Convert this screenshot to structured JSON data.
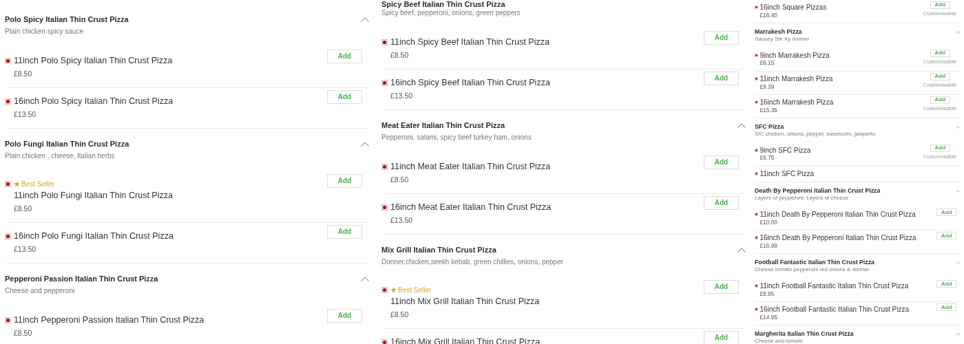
{
  "columns": [
    {
      "sections": [
        {
          "title": "Polo Spicy Italian Thin Crust Pizza",
          "description": "Plain chicken spicy sauce",
          "expanded": true,
          "items": [
            {
              "name": "11inch Polo Spicy Italian Thin Crust Pizza",
              "price": "£8.50",
              "button": "Add"
            },
            {
              "name": "16inch Polo Spicy Italian Thin Crust Pizza",
              "price": "£13.50",
              "button": "Add"
            }
          ]
        },
        {
          "title": "Polo Fungi Italian Thin Crust Pizza",
          "description": "Plain chicken , cheese, Italian herbs",
          "expanded": true,
          "items": [
            {
              "badge": "Best Seller",
              "name": "11inch Polo Fungi Italian Thin Crust Pizza",
              "price": "£8.50",
              "button": "Add"
            },
            {
              "name": "16inch Polo Fungi Italian Thin Crust Pizza",
              "price": "£13.50",
              "button": "Add"
            }
          ]
        },
        {
          "title": "Pepperoni Passion Italian Thin Crust Pizza",
          "description": "Cheese and pepperoni",
          "expanded": true,
          "items": [
            {
              "name": "11inch Pepperoni Passion Italian Thin Crust Pizza",
              "price": "£8.50",
              "button": "Add"
            }
          ]
        }
      ]
    },
    {
      "sections": [
        {
          "title": "Spicy Beef Italian Thin Crust Pizza",
          "description": "Spicy beef, pepperoni, onions, green peppers",
          "items": [
            {
              "name": "11inch Spicy Beef Italian Thin Crust Pizza",
              "price": "£8.50",
              "button": "Add"
            },
            {
              "name": "16inch Spicy Beef Italian Thin Crust Pizza",
              "price": "£13.50",
              "button": "Add"
            }
          ]
        },
        {
          "title": "Meat Eater Italian Thin Crust Pizza",
          "description": "Pepperoni, salami, spicy beef turkey ham, onions",
          "expanded": true,
          "items": [
            {
              "name": "11inch Meat Eater Italian Thin Crust Pizza",
              "price": "£8.50",
              "button": "Add"
            },
            {
              "name": "16inch Meat Eater Italian Thin Crust Pizza",
              "price": "£13.50",
              "button": "Add"
            }
          ]
        },
        {
          "title": "Mix Grill Italian Thin Crust Pizza",
          "description": "Donner,chicken,seekh kebab, green chillies, onions, pepper",
          "expanded": true,
          "items": [
            {
              "badge": "Best Seller",
              "name": "11inch Mix Grill Italian Thin Crust Pizza",
              "price": "£8.50",
              "button": "Add"
            },
            {
              "name": "16inch Mix Grill Italian Thin Crust Pizza",
              "button": "Add"
            }
          ]
        }
      ]
    },
    {
      "sections": [
        {
          "items": [
            {
              "name": "16inch Square Pizzas",
              "price": "£16.40",
              "button": "Add",
              "note": "Customisable"
            }
          ]
        },
        {
          "title": "Marrakesh Pizza",
          "description": "Saucey Stir fry donner",
          "expanded": true,
          "items": [
            {
              "name": "9inch Marrakesh Pizza",
              "price": "£6.15",
              "button": "Add",
              "note": "Customisable"
            },
            {
              "name": "11inch Marrakesh Pizza",
              "price": "£9.39",
              "button": "Add",
              "note": "Customisable"
            },
            {
              "name": "16inch Marrakesh Pizza",
              "price": "£15.35",
              "button": "Add",
              "note": "Customisable"
            }
          ]
        },
        {
          "title": "SFC Pizza",
          "description": "SfC chicken, onions, pepper, sweetcorn, jalapeño",
          "expanded": true,
          "items": [
            {
              "name": "9inch SFC Pizza",
              "price": "£6.75",
              "button": "Add",
              "note": "Customisable"
            },
            {
              "name": "11inch SFC Pizza"
            }
          ]
        },
        {
          "title": "Death By Pepperoni Italian Thin Crust Pizza",
          "description": "Layers of pepperoni. Layers of cheese",
          "expanded": true,
          "items": [
            {
              "name": "11inch Death By Pepperoni Italian Thin Crust Pizza",
              "price": "£10.00",
              "button": "Add"
            },
            {
              "name": "16inch Death By Pepperoni Italian Thin Crust Pizza",
              "price": "£16.99",
              "button": "Add"
            }
          ]
        },
        {
          "title": "Football Fantastic Italian Thin Crust Pizza",
          "description": "Cheese tomato pepperoni red onions & donner",
          "expanded": true,
          "items": [
            {
              "name": "11inch Football Fantastic Italian Thin Crust Pizza",
              "price": "£8.95",
              "button": "Add"
            },
            {
              "name": "16inch Football Fantastic Italian Thin Crust Pizza",
              "price": "£14.95",
              "button": "Add"
            }
          ]
        },
        {
          "title": "Margherita Italian Thin Crust Pizza",
          "description": "Cheese and tomato",
          "expanded": true
        }
      ]
    }
  ]
}
